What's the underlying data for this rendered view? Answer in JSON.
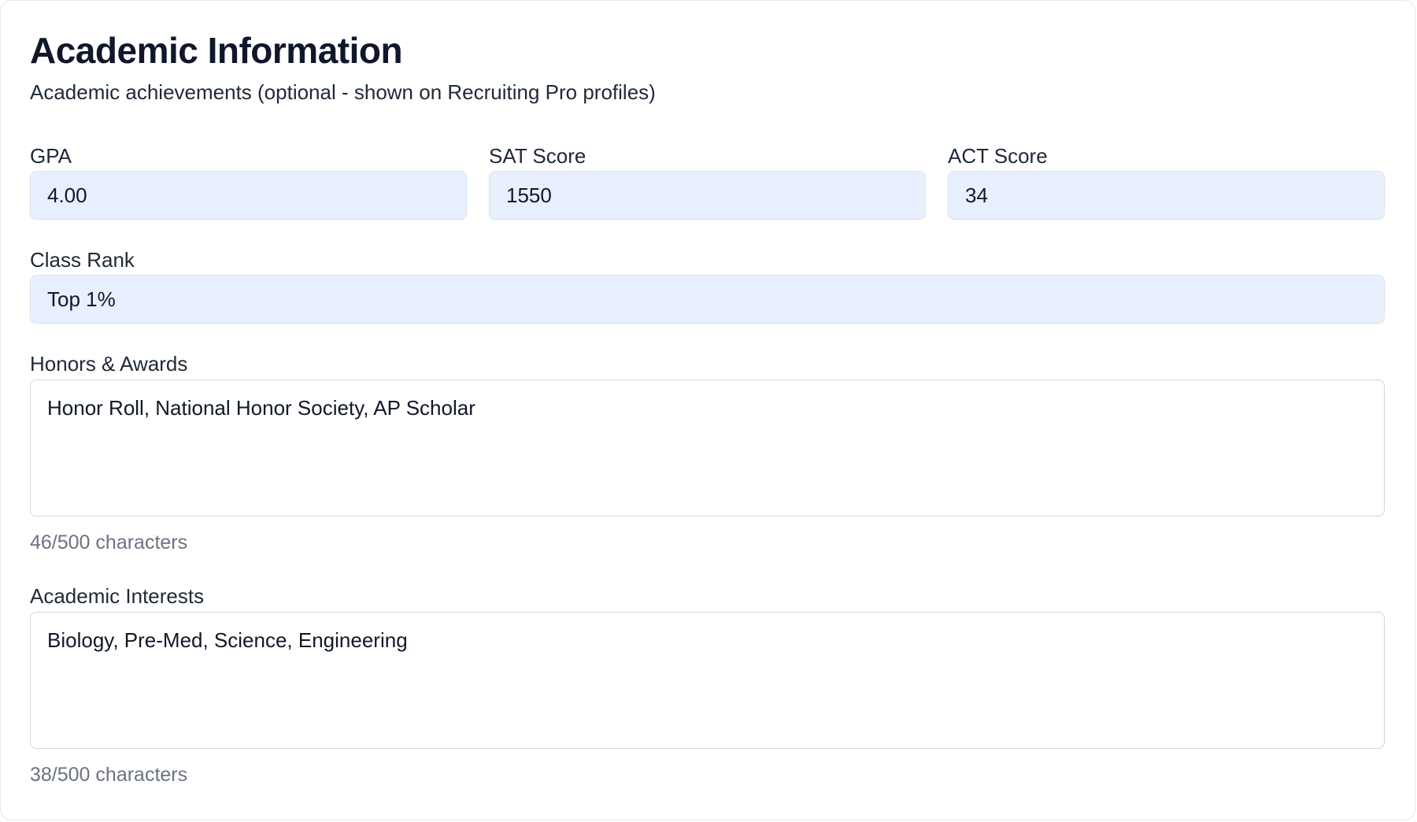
{
  "section": {
    "title": "Academic Information",
    "subtitle": "Academic achievements (optional - shown on Recruiting Pro profiles)"
  },
  "fields": {
    "gpa": {
      "label": "GPA",
      "value": "4.00"
    },
    "sat": {
      "label": "SAT Score",
      "value": "1550"
    },
    "act": {
      "label": "ACT Score",
      "value": "34"
    },
    "class_rank": {
      "label": "Class Rank",
      "value": "Top 1%"
    },
    "honors": {
      "label": "Honors & Awards",
      "value": "Honor Roll, National Honor Society, AP Scholar",
      "counter": "46/500 characters"
    },
    "interests": {
      "label": "Academic Interests",
      "value": "Biology, Pre-Med, Science, Engineering",
      "counter": "38/500 characters"
    }
  },
  "colors": {
    "autofill_bg": "#e8f0fe",
    "text": "#111827",
    "muted": "#6b7280",
    "border": "#d1d5db"
  }
}
